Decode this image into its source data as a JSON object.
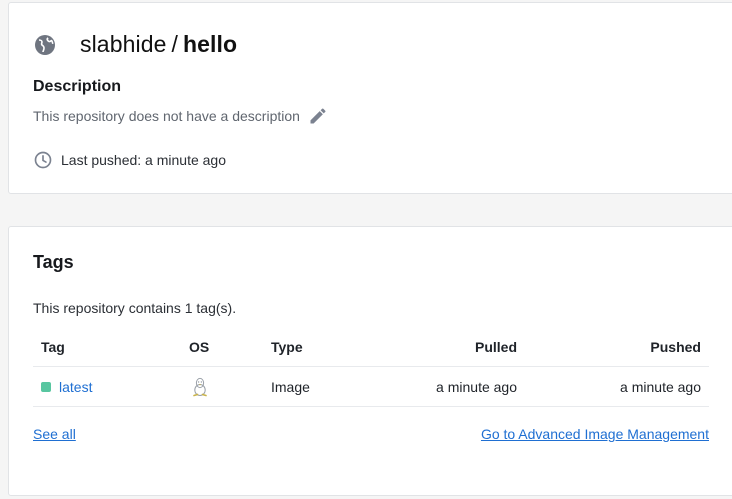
{
  "repo": {
    "namespace": "slabhide",
    "separator": "/",
    "name": "hello",
    "description_heading": "Description",
    "description_text": "This repository does not have a description",
    "last_pushed": "Last pushed: a minute ago"
  },
  "tags": {
    "heading": "Tags",
    "count_text": "This repository contains 1 tag(s).",
    "columns": {
      "tag": "Tag",
      "os": "OS",
      "type": "Type",
      "pulled": "Pulled",
      "pushed": "Pushed"
    },
    "rows": [
      {
        "tag": "latest",
        "os": "linux",
        "type": "Image",
        "pulled": "a minute ago",
        "pushed": "a minute ago"
      }
    ],
    "see_all": "See all",
    "advanced_link": "Go to Advanced Image Management"
  },
  "colors": {
    "accent": "#1f6fd2",
    "status_dot": "#58c6a0",
    "icon_gray": "#7b8290"
  }
}
